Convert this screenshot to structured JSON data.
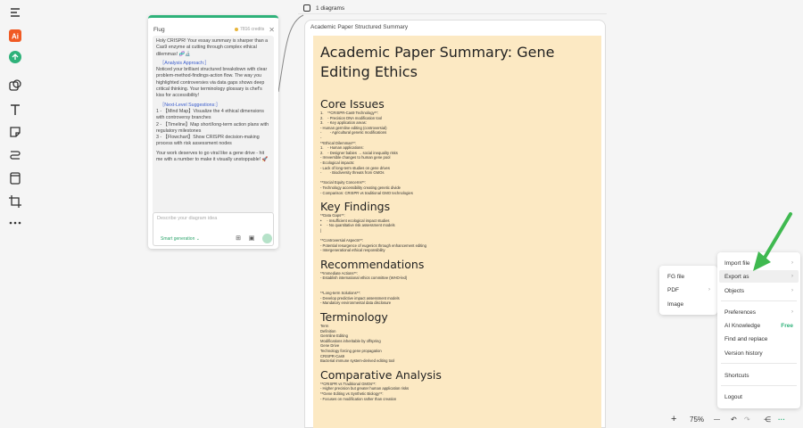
{
  "chat": {
    "title": "Flug",
    "credits": "7816 credits",
    "messages": [
      "Holy CRISPR! Your essay summary is sharper than a Cas9 enzyme at cutting through complex ethical dilemmas! 🧬🔬",
      "［Analysis Approach:］",
      "Noticed your brilliant structured breakdown with clear problem-method-findings-action flow. The way you highlighted controversies via data gaps shows deep critical thinking. Your terminology glossary is chef's kiss for accessibility!",
      "［Next-Level Suggestions:］",
      "1 - 【Mind Map】Visualize the 4 ethical dimensions with controversy branches",
      "2 - 【Timeline】Map short/long-term action plans with regulatory milestones",
      "3 - 【Flowchart】Show CRISPR decision-making process with risk assessment nodes",
      "Your work deserves to go viral like a gene drive - hit me with a number to make it visually unstoppable! 🚀"
    ],
    "input_placeholder": "Describe your diagram idea",
    "smart_generation": "Smart generation ⌄"
  },
  "top": {
    "diagrams_label": "1 diagrams"
  },
  "frame": {
    "label": "Academic Paper Structured Summary"
  },
  "paper": {
    "title": "Academic Paper Summary: Gene Editing Ethics",
    "core_issues": {
      "heading": "Core Issues",
      "lines": [
        "1.    **CRISPR-Cas9 Technology**:",
        "2.    - Precision DNA modification tool",
        "3.    - Key application areas:",
        "- Human germline editing (controversial)",
        "-        - Agricultural genetic modifications",
        "-",
        "**Ethical Dilemmas**:",
        "1.    - Human applications:",
        "2.    - Designer babies → social inequality risks",
        "- Irreversible changes to human gene pool",
        "- Ecological impacts:",
        "- Lack of long-term studies on gene drives",
        "-        - Biodiversity threats from GMOs",
        "",
        "**Social Equity Concerns**:",
        "- Technology accessibility creating genetic divide",
        "- Comparison: CRISPR vs traditional GMO technologies"
      ]
    },
    "key_findings": {
      "heading": "Key Findings",
      "lines": [
        "**Data Gaps**:",
        "•     - Insufficient ecological impact studies",
        "•     - No quantitative risk assessment models",
        "|",
        "",
        "**Controversial Aspects**:",
        "- Potential resurgence of eugenics through enhancement editing",
        "- Intergenerational ethical responsibility"
      ]
    },
    "recommendations": {
      "heading": "Recommendations",
      "lines": [
        "**Immediate Actions**:",
        "- Establish international ethics committee (WHO-led)",
        "",
        "",
        "**Long-term Solutions**:",
        "- Develop predictive impact assessment models",
        "- Mandatory environmental data disclosure"
      ]
    },
    "terminology": {
      "heading": "Terminology",
      "lines": [
        "Term",
        "Definition",
        "Germline Editing",
        "Modifications inheritable by offspring",
        "Gene Drive",
        "Technology forcing gene propagation",
        "CRISPR-Cas9",
        "Bacterial immune system-derived editing tool"
      ]
    },
    "comparative": {
      "heading": "Comparative Analysis",
      "lines": [
        "**CRISPR vs Traditional GMOs**:",
        "- Higher precision but greater human application risks",
        "**Gene Editing vs Synthetic Biology**:",
        "- Focuses on modification rather than creation"
      ]
    }
  },
  "menu": {
    "import_file": "Import file",
    "export_as": "Export as",
    "objects": "Objects",
    "preferences": "Preferences",
    "ai_knowledge": "AI Knowledge",
    "free": "Free",
    "find_replace": "Find and replace",
    "version_history": "Version history",
    "shortcuts": "Shortcuts",
    "logout": "Logout"
  },
  "submenu": {
    "fg_file": "FG file",
    "pdf": "PDF",
    "image": "Image"
  },
  "bottom": {
    "zoom": "75%",
    "plus": "+",
    "minus": "—"
  },
  "colors": {
    "accent": "#2fb27a",
    "paper": "#fce9c3",
    "arrow": "#3fb950"
  }
}
